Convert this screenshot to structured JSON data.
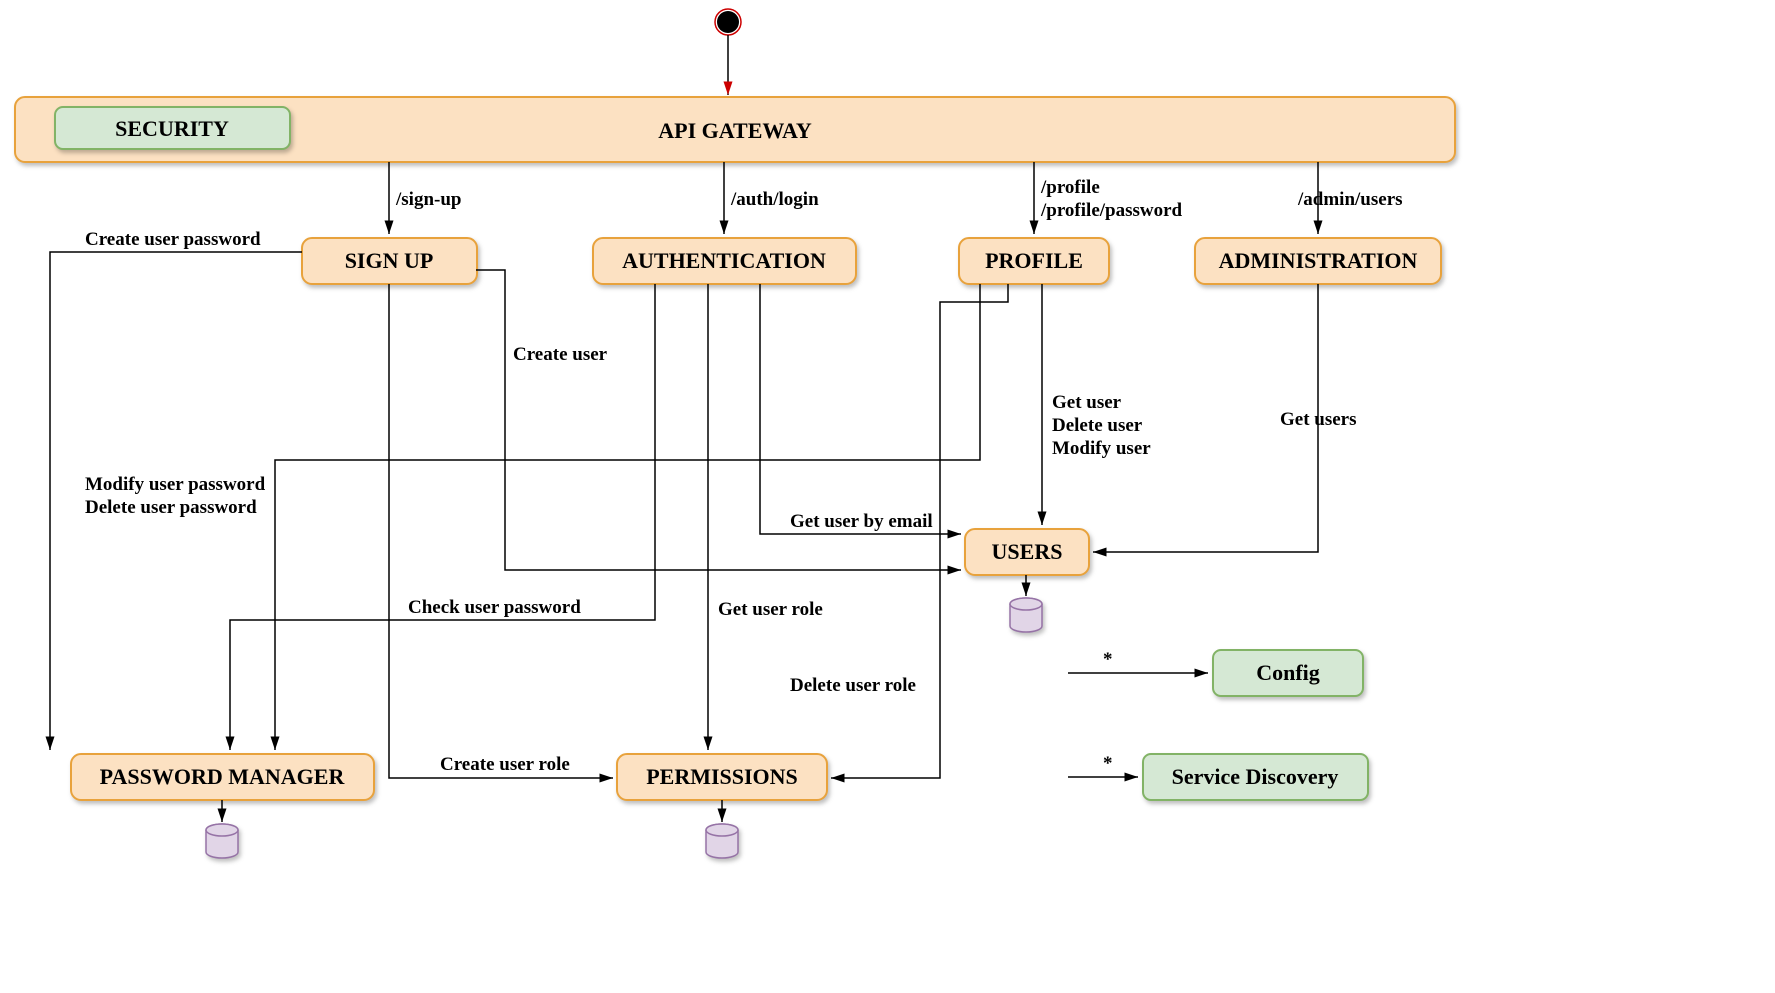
{
  "nodes": {
    "gateway": "API GATEWAY",
    "security": "SECURITY",
    "signup": "SIGN UP",
    "auth": "AUTHENTICATION",
    "profile": "PROFILE",
    "admin": "ADMINISTRATION",
    "users": "USERS",
    "pwmgr": "PASSWORD MANAGER",
    "perm": "PERMISSIONS",
    "config": "Config",
    "discovery": "Service Discovery"
  },
  "edges": {
    "signup_route": "/sign-up",
    "auth_route": "/auth/login",
    "profile_route1": "/profile",
    "profile_route2": "/profile/password",
    "admin_route": "/admin/users",
    "create_user_pw": "Create user password",
    "create_user": "Create user",
    "modify_user_pw": "Modify user password",
    "delete_user_pw": "Delete user password",
    "check_user_pw": "Check user password",
    "get_user_email": "Get user by email",
    "get_user_role": "Get user role",
    "delete_user_role": "Delete user role",
    "create_user_role": "Create user role",
    "get_user": "Get user",
    "delete_user": "Delete user",
    "modify_user": "Modify user",
    "get_users": "Get users",
    "star1": "*",
    "star2": "*"
  }
}
